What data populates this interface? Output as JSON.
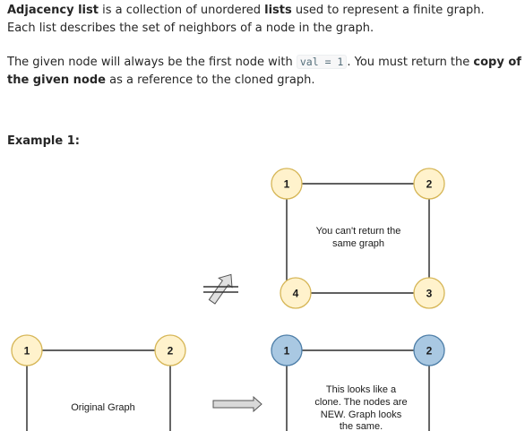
{
  "intro": {
    "line1_bold": "Adjacency list",
    "line1_a": " is a collection of unordered ",
    "line1_bold2": "lists",
    "line1_b": " used to represent a finite graph.",
    "line2": "Each list describes the set of neighbors of a node in the graph."
  },
  "rule": {
    "part1": "The given node will always be the first node with ",
    "code": "val = 1",
    "part2": ". You must return the ",
    "bold": "copy of the given node",
    "part3": " as a reference to the cloned graph."
  },
  "example": {
    "heading": "Example 1:"
  },
  "figure": {
    "colors": {
      "yellow_node": "#fff2cc",
      "yellow_stroke": "#d6b656",
      "blue_node": "#a9c8e2",
      "blue_stroke": "#4d7ea8",
      "edge": "#000000",
      "arrow_fill": "#d9d9d9"
    },
    "wrong_clone": {
      "nodes": [
        "1",
        "2",
        "4",
        "3"
      ],
      "caption_line1": "You can't return the",
      "caption_line2": "same graph"
    },
    "original": {
      "nodes": [
        "1",
        "2"
      ],
      "caption": "Original Graph"
    },
    "correct_clone": {
      "nodes": [
        "1",
        "2"
      ],
      "caption_lines": [
        "This looks like a",
        "clone. The nodes are",
        "NEW. Graph looks",
        "the same."
      ]
    },
    "not_equal_symbol": "not-equal-arrow-icon",
    "arrow_symbol": "right-arrow-icon"
  }
}
